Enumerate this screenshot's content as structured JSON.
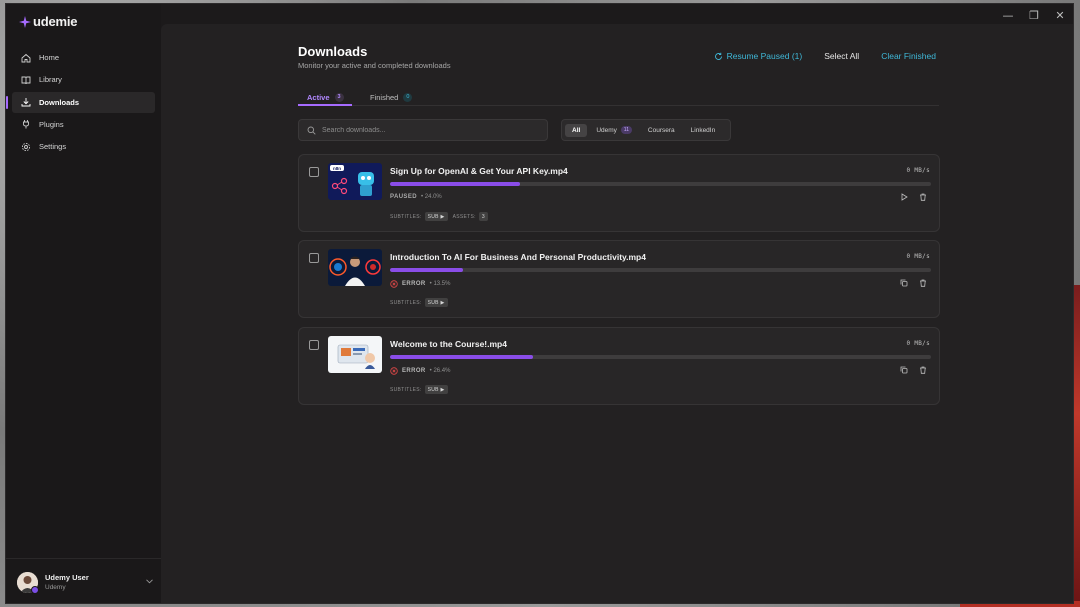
{
  "app": {
    "logo_text": "udemie"
  },
  "window_controls": [
    "—",
    "❐",
    "✕"
  ],
  "sidebar": {
    "items": [
      {
        "label": "Home",
        "icon": "home-icon"
      },
      {
        "label": "Library",
        "icon": "book-icon"
      },
      {
        "label": "Downloads",
        "icon": "download-icon",
        "active": true
      },
      {
        "label": "Plugins",
        "icon": "plug-icon"
      },
      {
        "label": "Settings",
        "icon": "gear-icon"
      }
    ],
    "user": {
      "name": "Udemy User",
      "subtitle": "Udemy"
    }
  },
  "header": {
    "title": "Downloads",
    "subtitle": "Monitor your active and completed downloads",
    "resume_label": "Resume Paused (1)",
    "select_all_label": "Select All",
    "clear_label": "Clear Finished"
  },
  "tabs": [
    {
      "label": "Active",
      "count": "3",
      "active": true
    },
    {
      "label": "Finished",
      "count": "0",
      "active": false
    }
  ],
  "search": {
    "placeholder": "Search downloads..."
  },
  "filters": [
    {
      "label": "All",
      "active": true
    },
    {
      "label": "Udemy",
      "count": "11"
    },
    {
      "label": "Coursera"
    },
    {
      "label": "LinkedIn"
    }
  ],
  "downloads": [
    {
      "name": "Sign Up for OpenAI & Get Your API Key.mp4",
      "speed": "0 MB/s",
      "progress": 24.0,
      "status": "PAUSED",
      "percent_text": "• 24.0%",
      "subtitles_label": "SUBTITLES:",
      "subtitles_value": "SUB ▶",
      "assets_label": "ASSETS:",
      "assets_value": "3",
      "thumb_text": "n8n"
    },
    {
      "name": "Introduction To AI For Business And Personal Productivity.mp4",
      "speed": "0 MB/s",
      "progress": 13.5,
      "status": "ERROR",
      "percent_text": "• 13.5%",
      "subtitles_label": "SUBTITLES:",
      "subtitles_value": "SUB ▶"
    },
    {
      "name": "Welcome to the Course!.mp4",
      "speed": "0 MB/s",
      "progress": 26.4,
      "status": "ERROR",
      "percent_text": "• 26.4%",
      "subtitles_label": "SUBTITLES:",
      "subtitles_value": "SUB ▶"
    }
  ],
  "colors": {
    "accent": "#a66bff",
    "progress": "#8a4de8",
    "link": "#3fb8d8",
    "error": "#e04848"
  }
}
